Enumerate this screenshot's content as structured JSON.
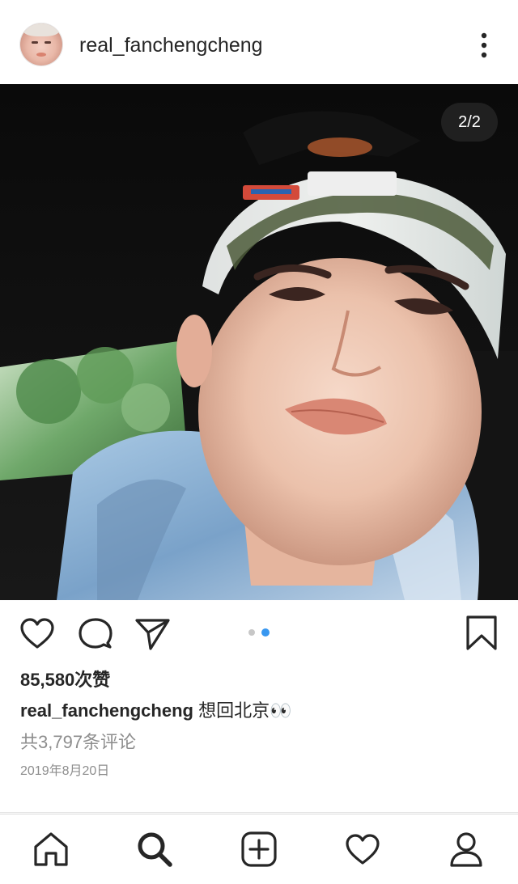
{
  "header": {
    "username": "real_fanchengcheng",
    "more_icon": "more-vertical-icon"
  },
  "post": {
    "image_counter": "2/2",
    "carousel": {
      "total": 2,
      "active_index": 1
    },
    "likes": "85,580次赞",
    "caption_username": "real_fanchengcheng",
    "caption_text": " 想回北京👀",
    "comments_link": "共3,797条评论",
    "date": "2019年8月20日"
  },
  "actions": {
    "like_icon": "heart-icon",
    "comment_icon": "comment-icon",
    "share_icon": "send-icon",
    "save_icon": "bookmark-icon"
  },
  "tabbar": {
    "items": [
      "home-icon",
      "search-icon",
      "new-post-icon",
      "activity-icon",
      "profile-icon"
    ],
    "active": "search-icon"
  },
  "colors": {
    "text": "#262626",
    "secondary_text": "#8e8e8e",
    "carousel_active_dot": "#3897f0",
    "carousel_inactive_dot": "#c7c7c7"
  }
}
